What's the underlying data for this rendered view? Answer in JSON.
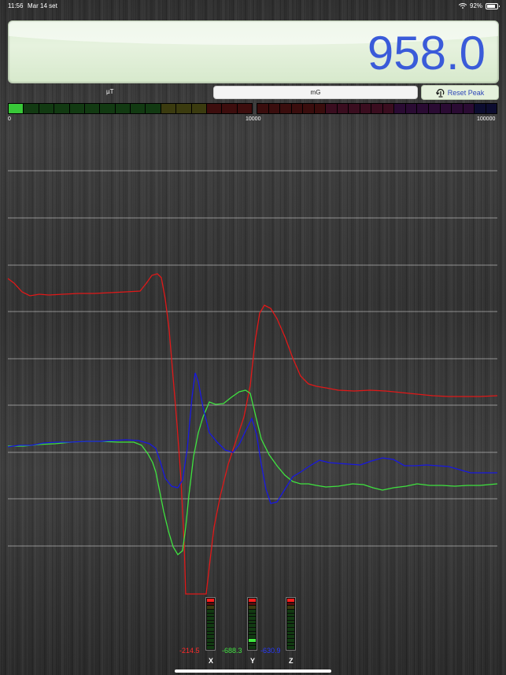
{
  "status_bar": {
    "time": "11:56",
    "date": "Mar 14 set",
    "battery": "92%"
  },
  "display": {
    "reading": "958.0",
    "reading_color": "#3a5bd9"
  },
  "controls": {
    "unit_left": "µT",
    "unit_button": "mG",
    "reset_label": "Reset Peak"
  },
  "meter_scale": {
    "left_min": "0",
    "left_max": "10000",
    "right_max": "100000"
  },
  "axes": [
    {
      "name": "X",
      "value": "-214.5",
      "color": "#ff2a2a"
    },
    {
      "name": "Y",
      "value": "-688.3",
      "color": "#44e544"
    },
    {
      "name": "Z",
      "value": "-630.9",
      "color": "#2a3bff"
    }
  ],
  "colors": {
    "x_trace": "#e01818",
    "y_trace": "#3fe23f",
    "z_trace": "#1818e0"
  }
}
